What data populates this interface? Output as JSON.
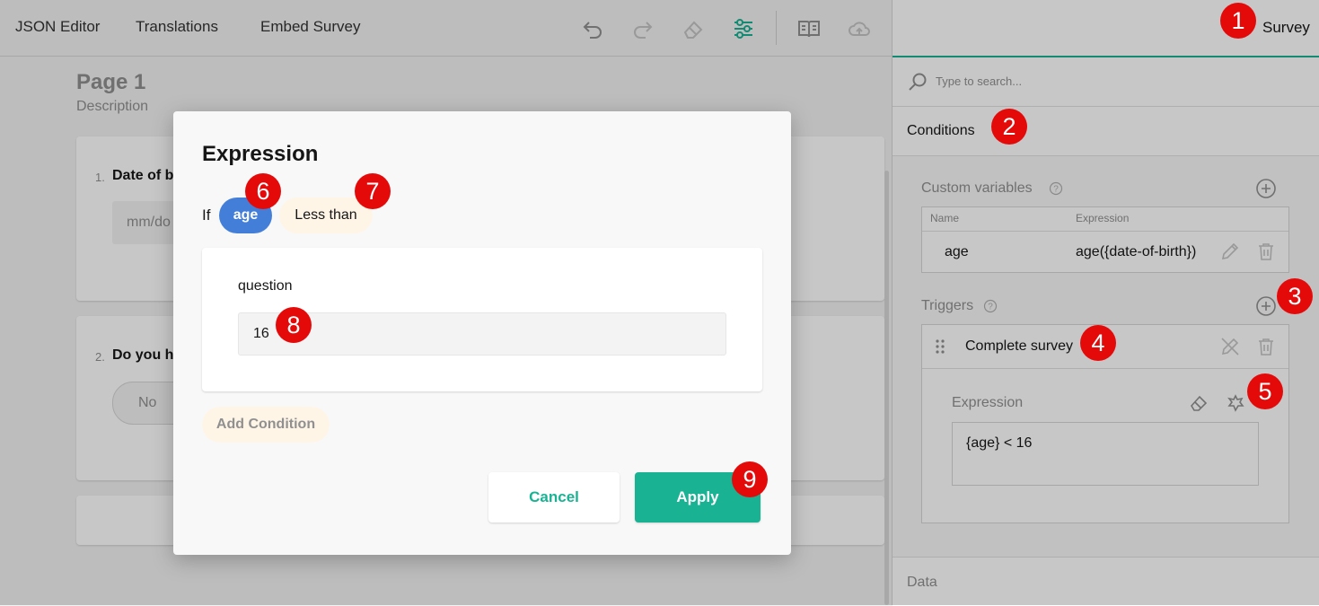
{
  "toolbar": {
    "tabs": [
      "JSON Editor",
      "Translations",
      "Embed Survey"
    ]
  },
  "designer": {
    "page_title": "Page 1",
    "page_description": "Description",
    "questions": [
      {
        "number": "1.",
        "title": "Date of b",
        "input_placeholder": "mm/do"
      },
      {
        "number": "2.",
        "title": "Do you ha",
        "choice": "No"
      }
    ]
  },
  "property_panel": {
    "header_tab": "Survey",
    "search_placeholder": "Type to search...",
    "conditions_label": "Conditions",
    "custom_variables": {
      "label": "Custom variables",
      "col_name": "Name",
      "col_expression": "Expression",
      "rows": [
        {
          "name": "age",
          "expression": "age({date-of-birth})"
        }
      ]
    },
    "triggers": {
      "label": "Triggers",
      "item": "Complete survey",
      "expression_label": "Expression",
      "expression_value": "{age} < 16"
    },
    "data_label": "Data"
  },
  "modal": {
    "title": "Expression",
    "if_label": "If",
    "variable_chip": "age",
    "operator_chip": "Less than",
    "value_label": "question",
    "value": "16",
    "add_condition": "Add Condition",
    "cancel": "Cancel",
    "apply": "Apply"
  },
  "callouts": [
    "1",
    "2",
    "3",
    "4",
    "5",
    "6",
    "7",
    "8",
    "9"
  ],
  "colors": {
    "accent": "#19b394",
    "variable_chip": "#437fd9",
    "operator_chip": "#fef5e7",
    "callout": "#e50a0a"
  }
}
